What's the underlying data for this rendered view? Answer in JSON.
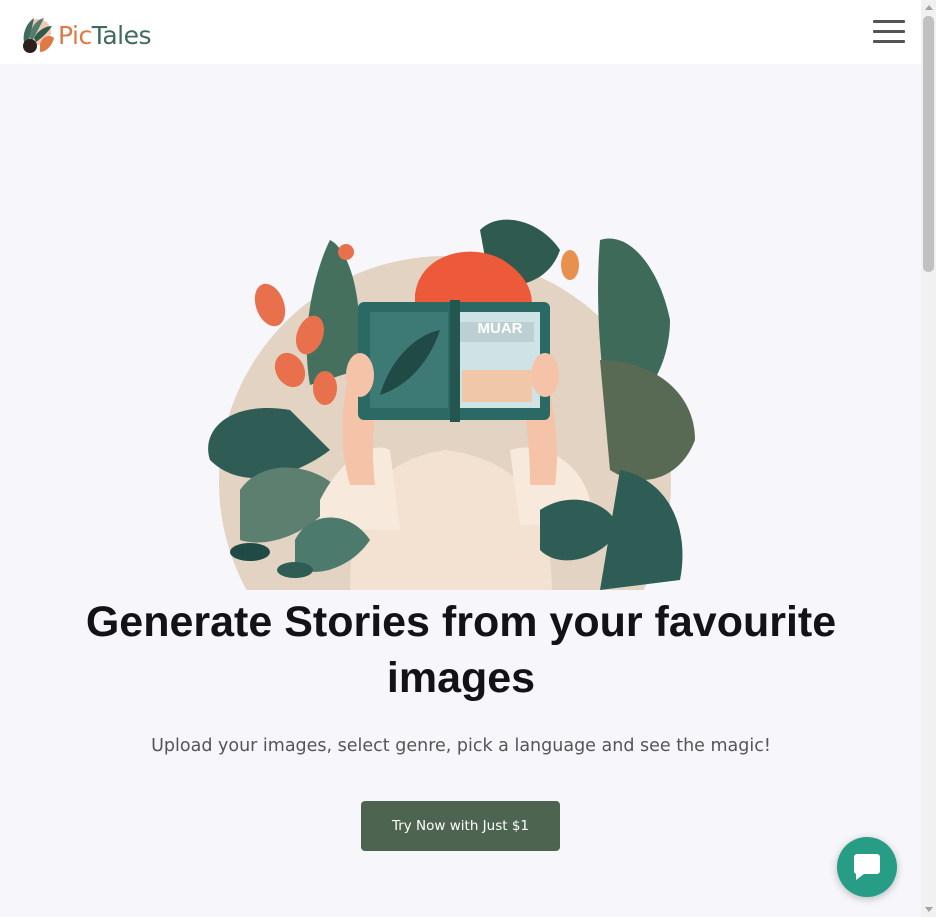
{
  "header": {
    "logo": {
      "pic": "Pic",
      "tales": "Tales"
    },
    "menu_icon": "hamburger-menu-icon"
  },
  "hero": {
    "image_description_icon": "woman-reading-book-illustration",
    "headline": "Generate Stories from your favourite images",
    "subline": "Upload your images, select genre, pick a language and see the magic!",
    "cta_label": "Try Now with Just $1",
    "book_cover_text": "MUAR"
  },
  "chat": {
    "icon": "chat-bubble-icon"
  },
  "colors": {
    "background": "#f7f6fb",
    "header_bg": "#ffffff",
    "cta_bg": "#4c6450",
    "chat_bg": "#279d86",
    "logo_orange": "#e07a45",
    "logo_green": "#3f6b5d"
  }
}
